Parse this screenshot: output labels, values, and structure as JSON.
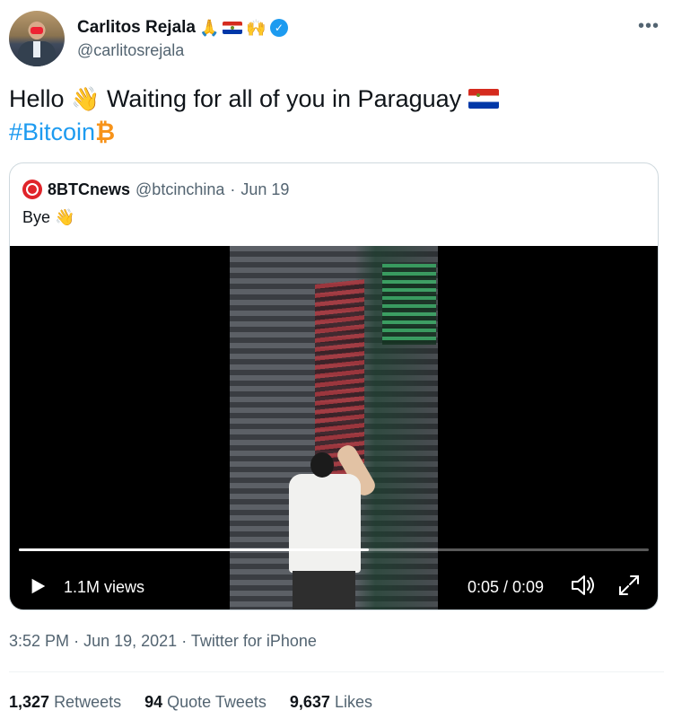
{
  "author": {
    "display_name": "Carlitos Rejala",
    "name_emojis": [
      "🙏",
      "🙌"
    ],
    "handle": "@carlitosrejala",
    "verified": true
  },
  "more_icon": "more-horizontal-icon",
  "tweet": {
    "text_line1_a": "Hello",
    "text_line1_b": "Waiting for all of you in Paraguay",
    "wave_emoji": "👋",
    "hashtag": "#Bitcoin",
    "bitcoin_symbol": "₿"
  },
  "quote": {
    "name": "8BTCnews",
    "handle": "@btcinchina",
    "separator": "·",
    "date": "Jun 19",
    "text": "Bye",
    "text_emoji": "👋"
  },
  "video": {
    "views": "1.1M views",
    "time": "0:05 / 0:09",
    "progress": 0.556,
    "play_icon": "play-icon",
    "volume_icon": "volume-icon",
    "fullscreen_icon": "fullscreen-icon"
  },
  "meta": {
    "time": "3:52 PM",
    "date": "Jun 19, 2021",
    "source": "Twitter for iPhone",
    "separator": "·"
  },
  "stats": [
    {
      "count": "1,327",
      "label": "Retweets"
    },
    {
      "count": "94",
      "label": "Quote Tweets"
    },
    {
      "count": "9,637",
      "label": "Likes"
    }
  ],
  "colors": {
    "accent": "#1d9bf0",
    "text_secondary": "#536471",
    "bitcoin": "#f7931a"
  }
}
